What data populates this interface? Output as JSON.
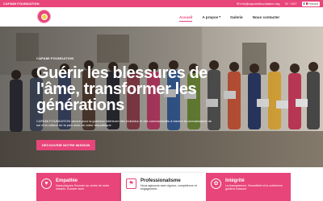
{
  "topbar": {
    "org_name": "CAPAMI FOUNDATION",
    "email": "info@capamifoundation.org",
    "phone": "+257",
    "language": "French"
  },
  "nav": {
    "items": [
      {
        "label": "Accueil",
        "active": true
      },
      {
        "label": "A propos",
        "dropdown": true
      },
      {
        "label": "Galerie"
      },
      {
        "label": "Nous contacter"
      }
    ]
  },
  "hero": {
    "kicker": "CAPAMI FOUNDATION",
    "headline": "Guérir les blessures de l'âme, transformer les générations",
    "subtitle": "CAPAMI FOUNDATION œuvre pour la guérison intérieure des individus et des communautés à travers la connaissance de soi et la culture de la paix avec un cœur empathique",
    "cta_label": "DÉCOUVRIR NOTRE MISSION"
  },
  "values": [
    {
      "title": "Empathie",
      "description": "Nous plaçons l'humain au centre de notre mission. Écouter avec",
      "icon": "heart-icon",
      "style": "pink"
    },
    {
      "title": "Professionalisme",
      "description": "Nous agissons avec rigueur, compétence et engagement.",
      "icon": "bookmark-icon",
      "style": "white"
    },
    {
      "title": "Intégrité",
      "description": "La transparence, l'honnêteté et la cohérence guident chacune",
      "icon": "flower-icon",
      "style": "pink"
    }
  ],
  "colors": {
    "accent": "#e8457a"
  }
}
